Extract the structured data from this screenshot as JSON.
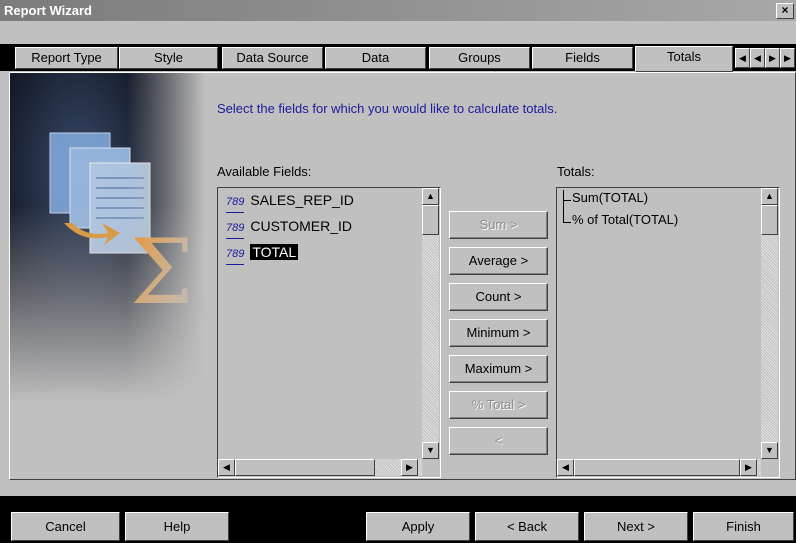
{
  "window": {
    "title": "Report Wizard",
    "close_glyph": "×"
  },
  "tabs": [
    "Report Type",
    "Style",
    "Data Source",
    "Data",
    "Groups",
    "Fields",
    "Totals"
  ],
  "instruction": "Select the fields for which you would like to calculate totals.",
  "available": {
    "label": "Available Fields:",
    "items": [
      "SALES_REP_ID",
      "CUSTOMER_ID",
      "TOTAL"
    ],
    "icon_text": "789",
    "selected_index": 2
  },
  "totals": {
    "label": "Totals:",
    "items": [
      "Sum(TOTAL)",
      "% of Total(TOTAL)"
    ]
  },
  "middle_buttons": {
    "sum": "Sum >",
    "average": "Average >",
    "count": "Count >",
    "minimum": "Minimum >",
    "maximum": "Maximum >",
    "pct_total": "% Total >",
    "remove": "<"
  },
  "footer": {
    "cancel": "Cancel",
    "help": "Help",
    "apply": "Apply",
    "back": "< Back",
    "next": "Next >",
    "finish": "Finish"
  },
  "icons": {
    "first": "first-page-icon",
    "prev": "prev-icon",
    "next": "next-icon",
    "last": "last-page-icon",
    "sigma": "sigma-icon"
  },
  "colors": {
    "instruction": "#1b1b9c",
    "sigma": "#f08c1e"
  }
}
